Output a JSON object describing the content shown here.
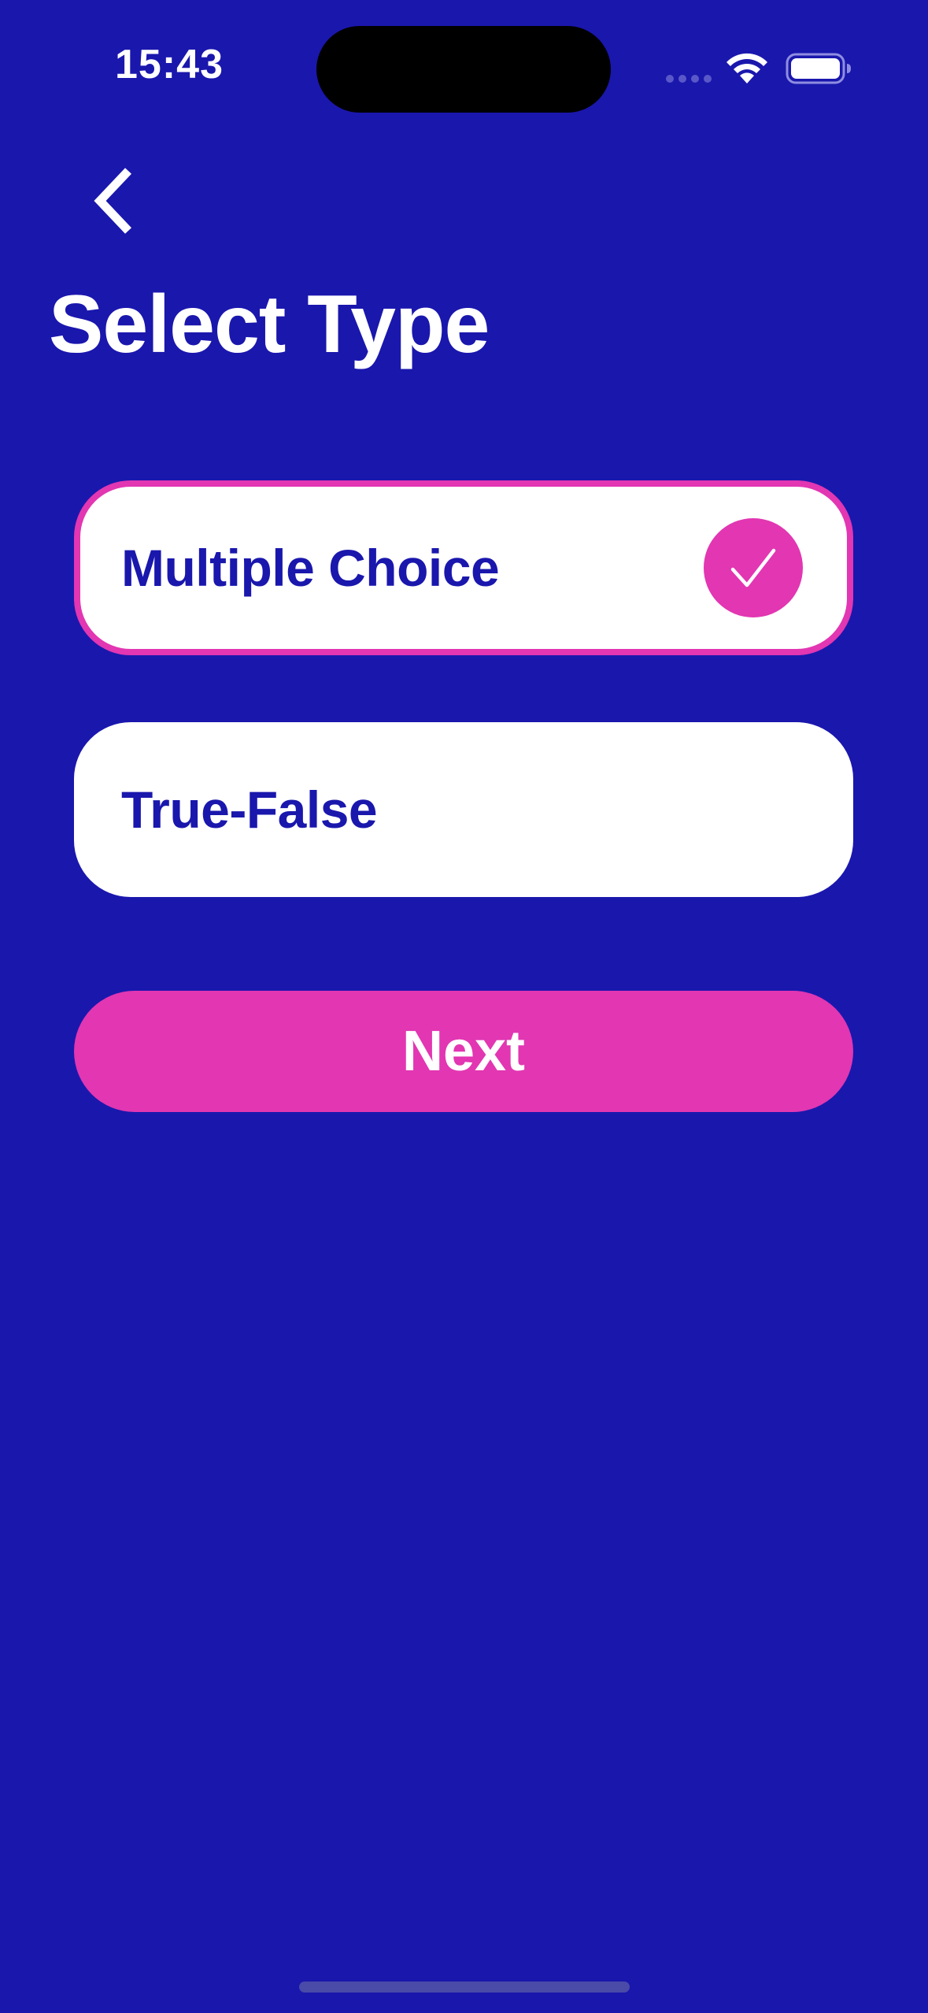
{
  "status_bar": {
    "time": "15:43"
  },
  "header": {
    "back_icon": "chevron-left-icon",
    "title": "Select Type"
  },
  "options": [
    {
      "label": "Multiple Choice",
      "selected": true
    },
    {
      "label": "True-False",
      "selected": false
    }
  ],
  "actions": {
    "next_label": "Next"
  },
  "colors": {
    "background": "#1A17AD",
    "accent": "#E236B2",
    "card": "#FFFFFF",
    "text_dark": "#1A17AD"
  }
}
